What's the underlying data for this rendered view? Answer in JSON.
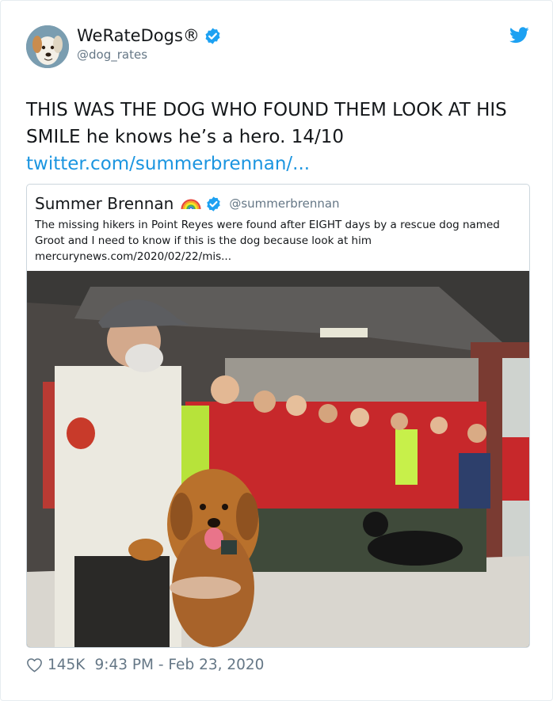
{
  "tweet": {
    "author": {
      "display_name": "WeRateDogs®",
      "handle": "@dog_rates",
      "verified": true
    },
    "text": "THIS WAS THE DOG WHO FOUND THEM LOOK AT HIS SMILE he knows he’s a hero. 14/10",
    "link": "twitter.com/summerbrennan/...",
    "quoted": {
      "display_name": "Summer Brennan",
      "emoji": "rainbow-emoji",
      "handle": "@summerbrennan",
      "verified": true,
      "text": "The missing hikers in Point Reyes were found after EIGHT days by a rescue dog named Groot and I need to know if this is the dog because look at him",
      "url": "mercurynews.com/2020/02/22/mis..."
    },
    "footer": {
      "likes": "145K",
      "timestamp": "9:43 PM - Feb 23, 2020"
    }
  },
  "icons": {
    "verified": "verified-badge-icon",
    "platform": "twitter-bird-icon",
    "like": "heart-icon"
  },
  "colors": {
    "link": "#1b95e0",
    "verified": "#1da1f2",
    "muted": "#657786",
    "border": "#ccd6dd"
  }
}
